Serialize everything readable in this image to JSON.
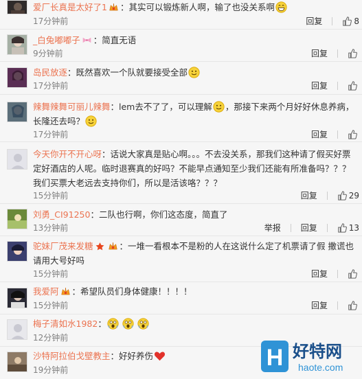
{
  "actions": {
    "reply": "回复",
    "report": "举报"
  },
  "comments": [
    {
      "user": "爱厂长真是太好了1",
      "text": "：其实可以锻炼新人啊，输了也没关系啊",
      "time": "17分钟前",
      "likes": "8",
      "avatar_color": "#2e2a2a"
    },
    {
      "user": "_白兔嘟嘟子",
      "text": "：简直无语",
      "time": "9分钟前",
      "likes": "",
      "avatar_color": "#a6b0a5"
    },
    {
      "user": "岛民放逐",
      "text": "：既然喜欢一个队就要接受全部",
      "time": "17分钟前",
      "likes": "",
      "avatar_color": "#5a2e54"
    },
    {
      "user": "辣舞辣舞可丽儿辣舞",
      "text": "：lem去不了了，可以理解",
      "text2": "，那接下来两个月好好休息养病，长隆还去吗？",
      "time": "17分钟前",
      "likes": "",
      "avatar_color": "#5c6f7a"
    },
    {
      "user": "今天你开不开心呀",
      "text": "：话说大家真是贴心啊。。。不去没关系，那我们这种请了假买好票定好酒店的人呢。临时退赛真的好吗？不能早点通知至少我们还能有所准备吗？？？我们买票大老远去支持你们，所以是活该咯？？？",
      "time": "15分钟前",
      "likes": "29",
      "avatar_color": "#e4e4ea"
    },
    {
      "user": "刘勇_CI91250",
      "text": "：二队也行啊，你们这态度，简直了",
      "time": "13分钟前",
      "likes": "13",
      "avatar_color": "#6b8a3a"
    },
    {
      "user": "驼妹厂茂来发糖",
      "text": "：一堆一看根本不是粉的人在这说什么定了机票请了假 撒谎也请用大号好吗",
      "time": "15分钟前",
      "likes": "",
      "avatar_color": "#3b3f6e"
    },
    {
      "user": "我爱阿",
      "text": "：希望队员们身体健康！！！！",
      "time": "15分钟前",
      "likes": "",
      "avatar_color": "#2a2a35"
    },
    {
      "user": "梅子清如水1982",
      "text": "：",
      "time": "12分钟前",
      "likes": "",
      "avatar_color": "#e8e8ec"
    },
    {
      "user": "沙特阿拉伯戈壁教主",
      "text": "：好好养伤",
      "time": "19分钟前",
      "likes": "",
      "avatar_color": "#8d7a66"
    }
  ],
  "watermark": {
    "brand": "好特网",
    "url": "haote.com",
    "logo_letter": "H"
  }
}
